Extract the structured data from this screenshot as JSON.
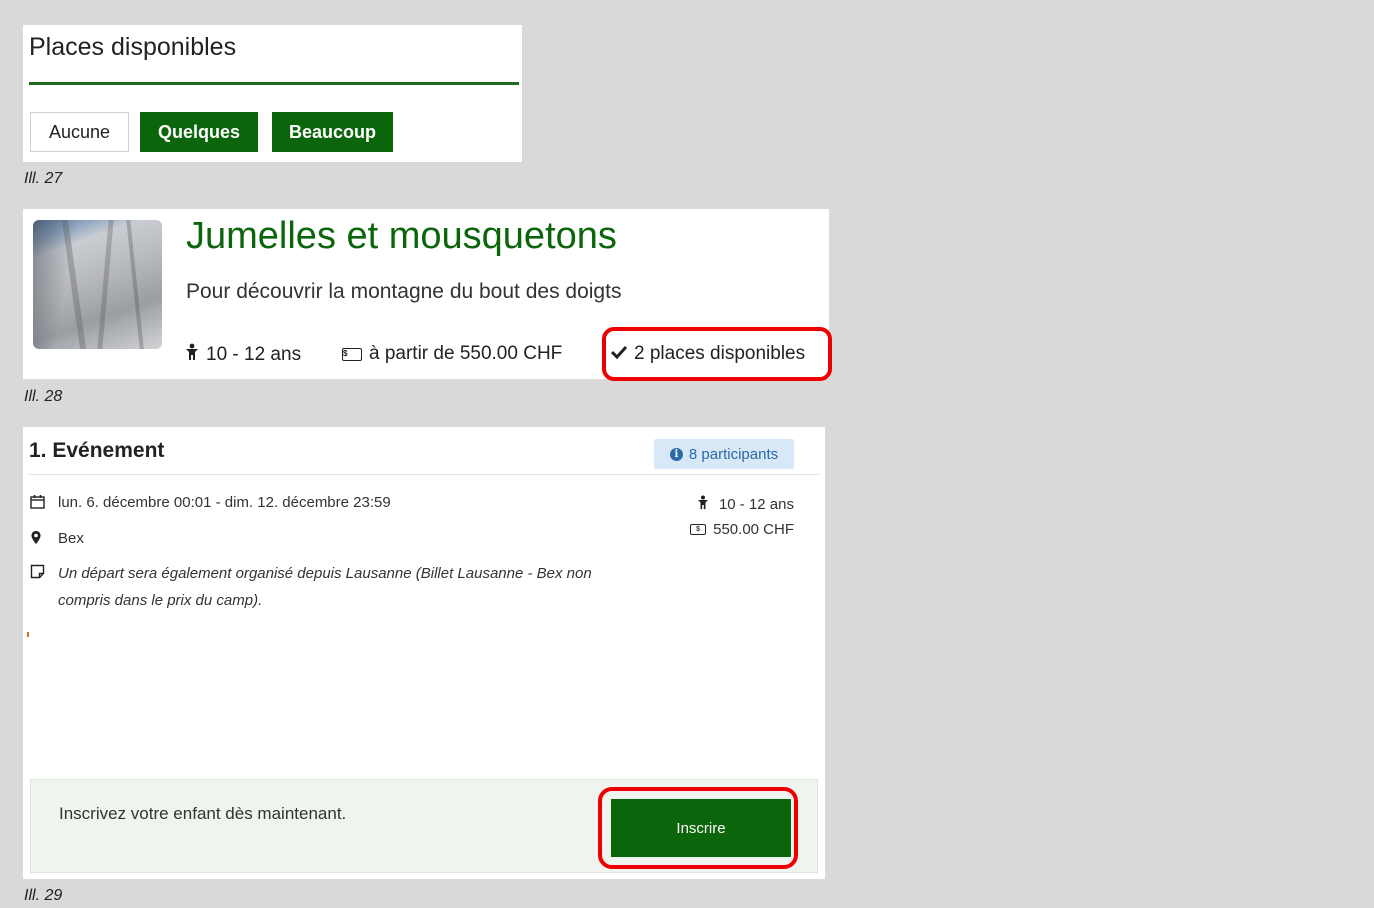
{
  "ill27": {
    "title": "Places disponibles",
    "buttons": {
      "none": "Aucune",
      "some": "Quelques",
      "many": "Beaucoup"
    },
    "caption": "Ill. 27"
  },
  "ill28": {
    "title": "Jumelles et mousquetons",
    "subtitle": "Pour découvrir la montagne du bout des doigts",
    "age": "10 - 12 ans",
    "price": "à partir de 550.00 CHF",
    "places": "2 places disponibles",
    "caption": "Ill. 28"
  },
  "ill29": {
    "event_title": "1. Evénement",
    "participants": "8 participants",
    "date": "lun. 6. décembre 00:01 - dim. 12. décembre 23:59",
    "place": "Bex",
    "note": "Un départ sera également organisé depuis Lausanne (Billet Lausanne - Bex non compris dans le prix du camp).",
    "age": "10 - 12 ans",
    "price": "550.00 CHF",
    "cta_text": "Inscrivez votre enfant dès maintenant.",
    "cta_button": "Inscrire",
    "caption": "Ill. 29"
  },
  "colors": {
    "green": "#0b650b",
    "highlight": "#ee0000",
    "badge_bg": "#d9e8f6"
  },
  "icons": [
    "child-icon",
    "money-icon",
    "check-icon",
    "calendar-icon",
    "map-marker-icon",
    "note-icon",
    "info-icon"
  ]
}
